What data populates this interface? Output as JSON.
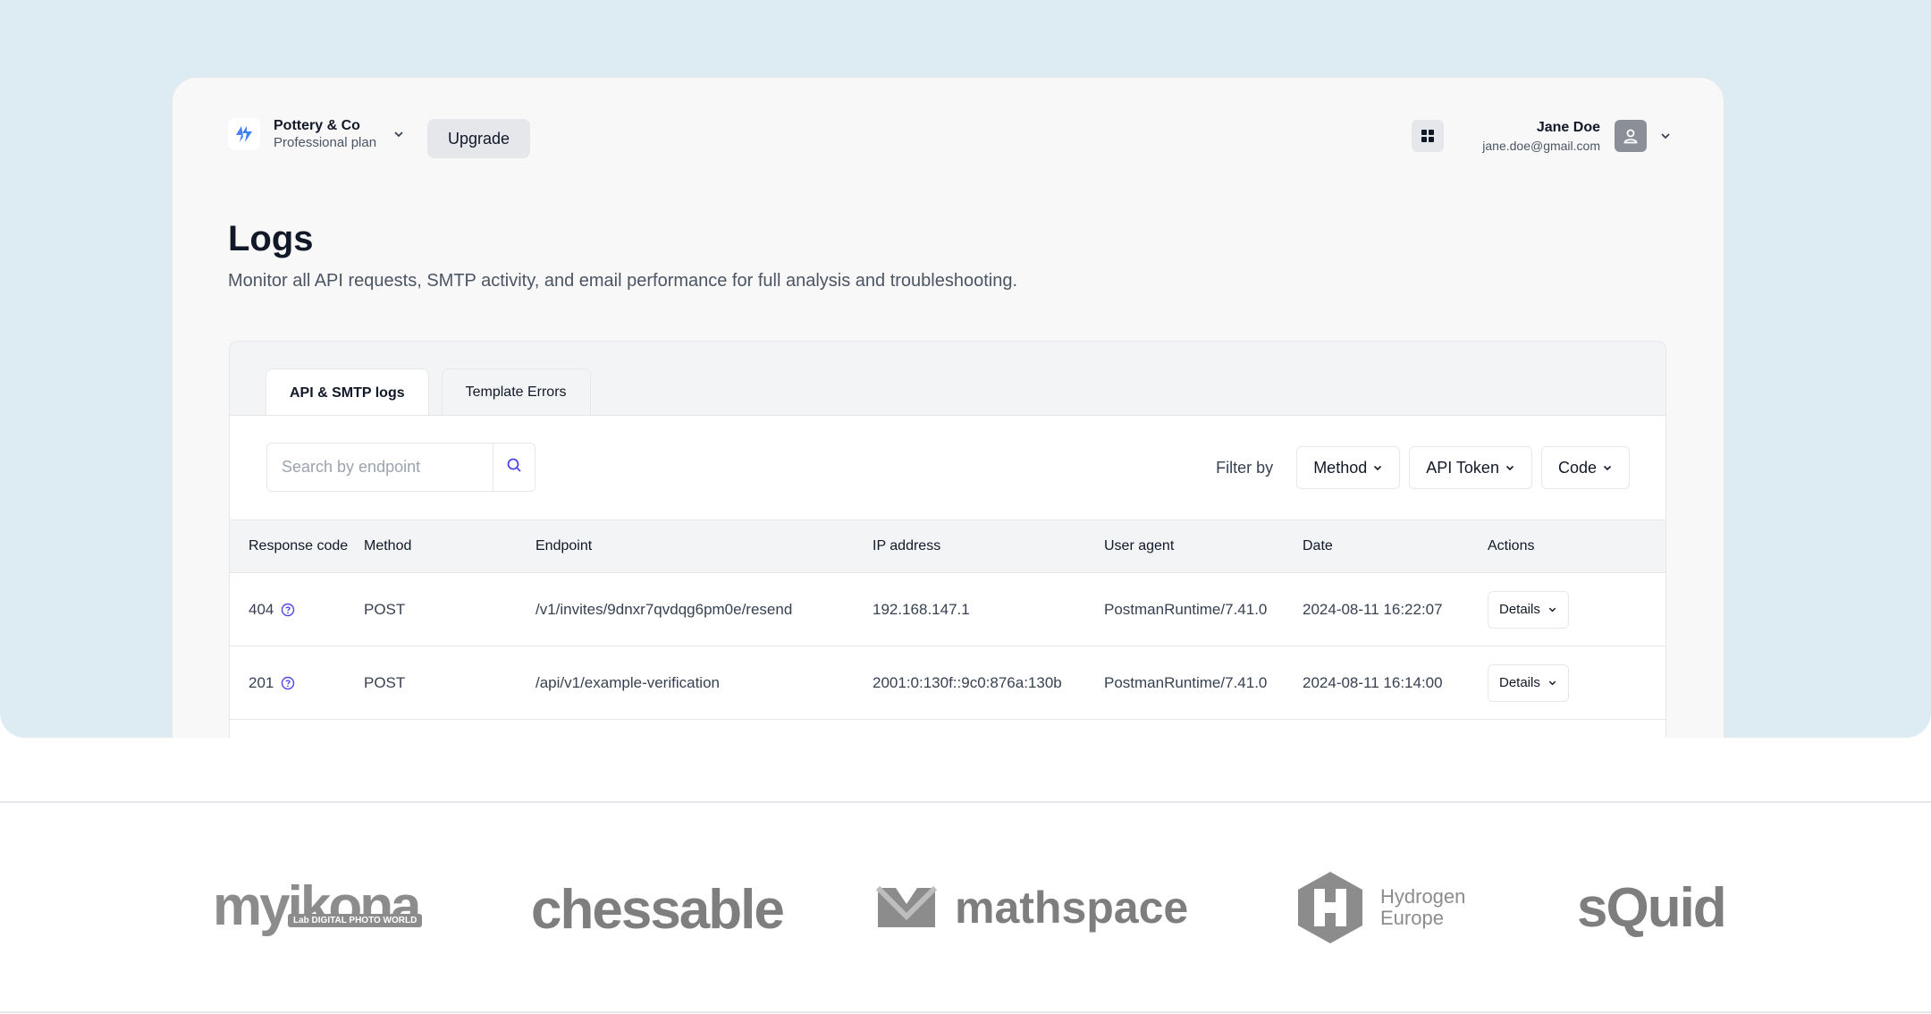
{
  "workspace": {
    "name": "Pottery & Co",
    "plan": "Professional plan"
  },
  "header": {
    "upgrade_label": "Upgrade"
  },
  "user": {
    "name": "Jane Doe",
    "email": "jane.doe@gmail.com"
  },
  "page": {
    "title": "Logs",
    "subtitle": "Monitor all API requests, SMTP activity, and email performance for full analysis and troubleshooting."
  },
  "tabs": [
    {
      "label": "API & SMTP logs",
      "active": true
    },
    {
      "label": "Template Errors",
      "active": false
    }
  ],
  "search": {
    "placeholder": "Search by endpoint",
    "value": ""
  },
  "filters": {
    "label": "Filter by",
    "options": [
      "Method",
      "API Token",
      "Code"
    ]
  },
  "table": {
    "columns": [
      "Response code",
      "Method",
      "Endpoint",
      "IP address",
      "User agent",
      "Date",
      "Actions"
    ],
    "rows": [
      {
        "code": "404",
        "method": "POST",
        "endpoint": "/v1/invites/9dnxr7qvdqg6pm0e/resend",
        "ip": "192.168.147.1",
        "agent": "PostmanRuntime/7.41.0",
        "date": "2024-08-11 16:22:07",
        "action": "Details"
      },
      {
        "code": "201",
        "method": "POST",
        "endpoint": "/api/v1/example-verification",
        "ip": "2001:0:130f::9c0:876a:130b",
        "agent": "PostmanRuntime/7.41.0",
        "date": "2024-08-11 16:14:00",
        "action": "Details"
      }
    ]
  },
  "logos": {
    "myikona": "myikona",
    "myikona_sub": "Lab DIGITAL PHOTO WORLD",
    "chessable": "chessable",
    "mathspace": "mathspace",
    "hydrogen_line1": "Hydrogen",
    "hydrogen_line2": "Europe",
    "squid": "sQuid"
  },
  "colors": {
    "hero_bg": "#ddebf3",
    "accent": "#4f46e5",
    "logo_gray": "#8c8c8c"
  }
}
